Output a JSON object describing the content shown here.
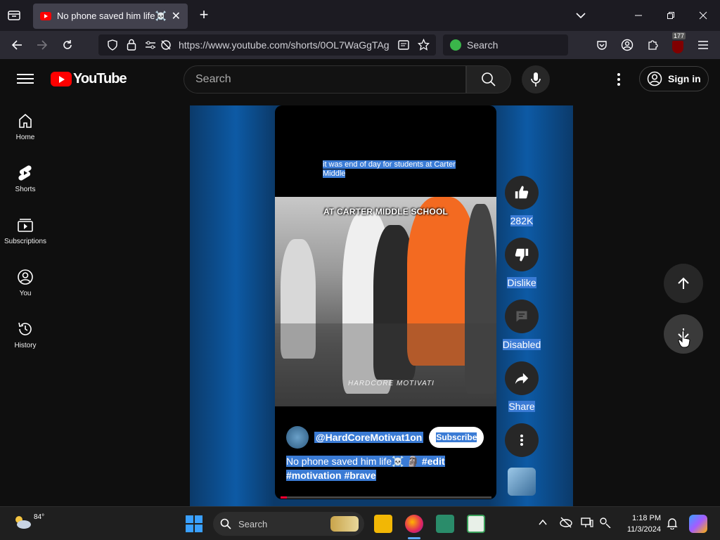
{
  "browser": {
    "tab_title": "No phone saved him life☠️ 🗿",
    "tab_close": "✕",
    "new_tab": "+",
    "url": "https://www.youtube.com/shorts/0OL7WaGgTAg",
    "search_placeholder": "Search",
    "extension_badge": "177"
  },
  "youtube": {
    "logo_text": "YouTube",
    "search_placeholder": "Search",
    "sign_in_label": "Sign in",
    "guide": [
      {
        "label": "Home",
        "icon": "home-icon"
      },
      {
        "label": "Shorts",
        "icon": "shorts-icon"
      },
      {
        "label": "Subscriptions",
        "icon": "subscriptions-icon"
      },
      {
        "label": "You",
        "icon": "you-icon"
      },
      {
        "label": "History",
        "icon": "history-icon"
      }
    ],
    "short": {
      "top_caption": "it was end of day for students at Carter Middle",
      "overlay_text": "AT CARTER MIDDLE SCHOOL",
      "watermark": "HARDCORE MOTIVATI",
      "channel": "@HardCoreMotivat1on",
      "subscribe_label": "Subscribe",
      "title_plain": "No phone saved him life☠️ 🗿 ",
      "title_tags": "#edit #motivation #brave",
      "progress": 0.03
    },
    "actions": {
      "like_count": "282K",
      "dislike_label": "Dislike",
      "comments_label": "Disabled",
      "share_label": "Share"
    }
  },
  "taskbar": {
    "weather_temp": "84°",
    "search_label": "Search",
    "time": "1:18 PM",
    "date": "11/3/2024"
  },
  "colors": {
    "yt_red": "#ff0000",
    "selection_blue": "#3a7bd5",
    "shorts_bg_blue": "#0b3a6a"
  }
}
